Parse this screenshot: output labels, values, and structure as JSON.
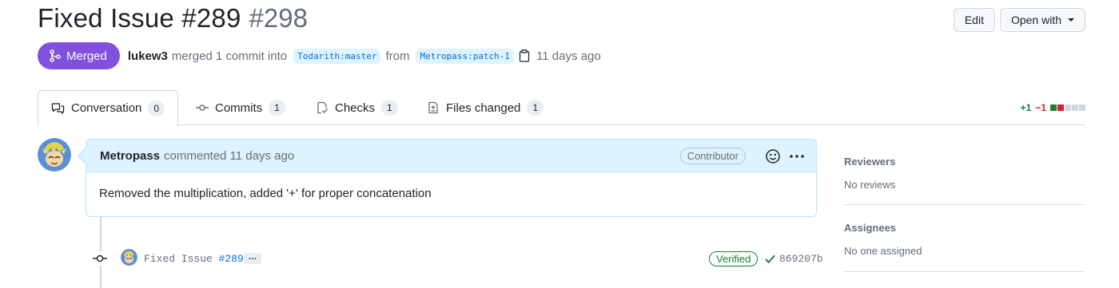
{
  "header": {
    "title": "Fixed Issue #289",
    "number": "#298",
    "edit_label": "Edit",
    "open_with_label": "Open with"
  },
  "meta": {
    "state": "Merged",
    "author": "lukew3",
    "action": "merged 1 commit into",
    "base_branch": "Todarith:master",
    "from_word": "from",
    "head_branch": "Metropass:patch-1",
    "time": "11 days ago"
  },
  "tabs": [
    {
      "label": "Conversation",
      "count": "0",
      "icon": "comment-discussion-icon"
    },
    {
      "label": "Commits",
      "count": "1",
      "icon": "git-commit-icon"
    },
    {
      "label": "Checks",
      "count": "1",
      "icon": "checklist-icon"
    },
    {
      "label": "Files changed",
      "count": "1",
      "icon": "file-diff-icon"
    }
  ],
  "diffstat": {
    "additions": "+1",
    "deletions": "−1"
  },
  "comment": {
    "author": "Metropass",
    "action": "commented 11 days ago",
    "role": "Contributor",
    "body": "Removed the multiplication, added '+' for proper concatenation"
  },
  "commit": {
    "message_prefix": "Fixed Issue ",
    "message_link": "#289",
    "ellipsis": "…",
    "verified": "Verified",
    "sha": "869207b"
  },
  "sidebar": {
    "reviewers_label": "Reviewers",
    "reviewers_value": "No reviews",
    "assignees_label": "Assignees",
    "assignees_value": "No one assigned"
  },
  "colors": {
    "merged": "#8250df",
    "link": "#0969da",
    "success": "#1a7f37",
    "danger": "#cf222e"
  }
}
